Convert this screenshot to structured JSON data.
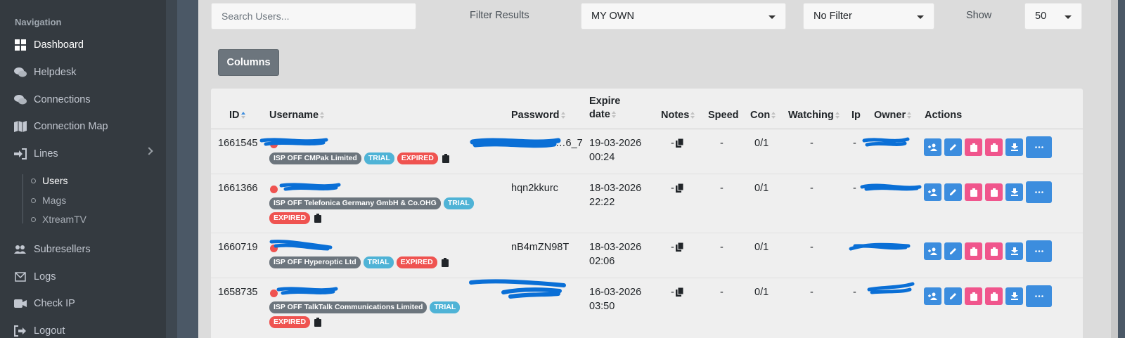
{
  "sidebar": {
    "header": "Navigation",
    "items": [
      {
        "label": "Dashboard",
        "icon": "dashboard-icon"
      },
      {
        "label": "Helpdesk",
        "icon": "chat-icon"
      },
      {
        "label": "Connections",
        "icon": "chat-icon"
      },
      {
        "label": "Connection Map",
        "icon": "map-icon"
      },
      {
        "label": "Lines",
        "icon": "sign-in-icon"
      },
      {
        "label": "Subresellers",
        "icon": "users-icon"
      },
      {
        "label": "Logs",
        "icon": "mail-icon"
      },
      {
        "label": "Check IP",
        "icon": "video-icon"
      },
      {
        "label": "Logout",
        "icon": "logout-icon"
      }
    ],
    "sub_items": [
      {
        "label": "Users"
      },
      {
        "label": "Mags"
      },
      {
        "label": "XtreamTV"
      }
    ]
  },
  "toolbar": {
    "search_placeholder": "Search Users...",
    "filter_label": "Filter Results",
    "owner_select": "MY OWN",
    "filter_select": "No Filter",
    "show_label": "Show",
    "show_select": "50",
    "columns_button": "Columns"
  },
  "table": {
    "headers": {
      "id": "ID",
      "username": "Username",
      "password": "Password",
      "expire_1": "Expire",
      "expire_2": "date",
      "notes": "Notes",
      "speed": "Speed",
      "con": "Con",
      "watching": "Watching",
      "ip": "Ip",
      "owner": "Owner",
      "actions": "Actions"
    },
    "rows": [
      {
        "id": "1661545",
        "password": "…6_7",
        "expire_date": "19-03-2026",
        "expire_time": "00:24",
        "notes": "-",
        "speed": "-",
        "con": "0/1",
        "watching": "-",
        "ip": "-",
        "isp": "ISP OFF CMPak Limited",
        "trial": "TRIAL",
        "expired": "EXPIRED"
      },
      {
        "id": "1661366",
        "password": "hqn2kkurc",
        "expire_date": "18-03-2026",
        "expire_time": "22:22",
        "notes": "-",
        "speed": "-",
        "con": "0/1",
        "watching": "-",
        "ip": "-",
        "isp": "ISP OFF Telefonica Germany GmbH & Co.OHG",
        "trial": "TRIAL",
        "expired": "EXPIRED"
      },
      {
        "id": "1660719",
        "password": "nB4mZN98T",
        "expire_date": "18-03-2026",
        "expire_time": "02:06",
        "notes": "-",
        "speed": "-",
        "con": "0/1",
        "watching": "-",
        "ip": "-",
        "isp": "ISP OFF Hyperoptic Ltd",
        "trial": "TRIAL",
        "expired": "EXPIRED"
      },
      {
        "id": "1658735",
        "password": "",
        "expire_date": "16-03-2026",
        "expire_time": "03:50",
        "notes": "-",
        "speed": "-",
        "con": "0/1",
        "watching": "-",
        "ip": "-",
        "isp": "ISP OFF TalkTalk Communications Limited",
        "trial": "TRIAL",
        "expired": "EXPIRED"
      }
    ]
  },
  "colors": {
    "primary": "#3c8dde",
    "pink": "#f0558c",
    "danger": "#ef5350",
    "info": "#4fb3d6",
    "secondary": "#6c757d",
    "sidebar": "#343a40",
    "redaction": "#0a6fd6"
  }
}
